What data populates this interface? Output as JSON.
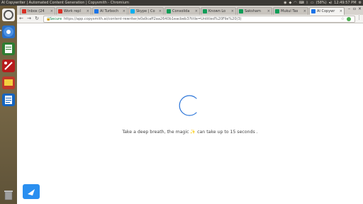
{
  "os_panel": {
    "window_title": "AI Copywriter | Automated Content Generation | Copysmith - Chromium",
    "battery": "(58%)",
    "time": "12:49:57 PM"
  },
  "browser": {
    "tabs": [
      {
        "label": "Inbox (24",
        "favicon_color": "#d93025"
      },
      {
        "label": "Work repl",
        "favicon_color": "#d93025"
      },
      {
        "label": "AI Turboch",
        "favicon_color": "#1a73e8"
      },
      {
        "label": "Skype | Co",
        "favicon_color": "#00aff0"
      },
      {
        "label": "Consolida",
        "favicon_color": "#0f9d58"
      },
      {
        "label": "Known Lo",
        "favicon_color": "#0f9d58"
      },
      {
        "label": "Saksham",
        "favicon_color": "#0f9d58"
      },
      {
        "label": "Mukul Tas",
        "favicon_color": "#0f9d58"
      },
      {
        "label": "AI Copywr",
        "favicon_color": "#1a73e8",
        "active": true
      }
    ],
    "address": {
      "secure_label": "Secure",
      "url": "https://app.copysmith.ai/content-rewriter/e0a9caff2aa2640b1eacbeb3?title=Untitled%20File%20(3)"
    }
  },
  "page": {
    "loading_message": "Take a deep breath, the magic ✨ can take up to 15 seconds .",
    "accent_color": "#2a8ff0"
  }
}
